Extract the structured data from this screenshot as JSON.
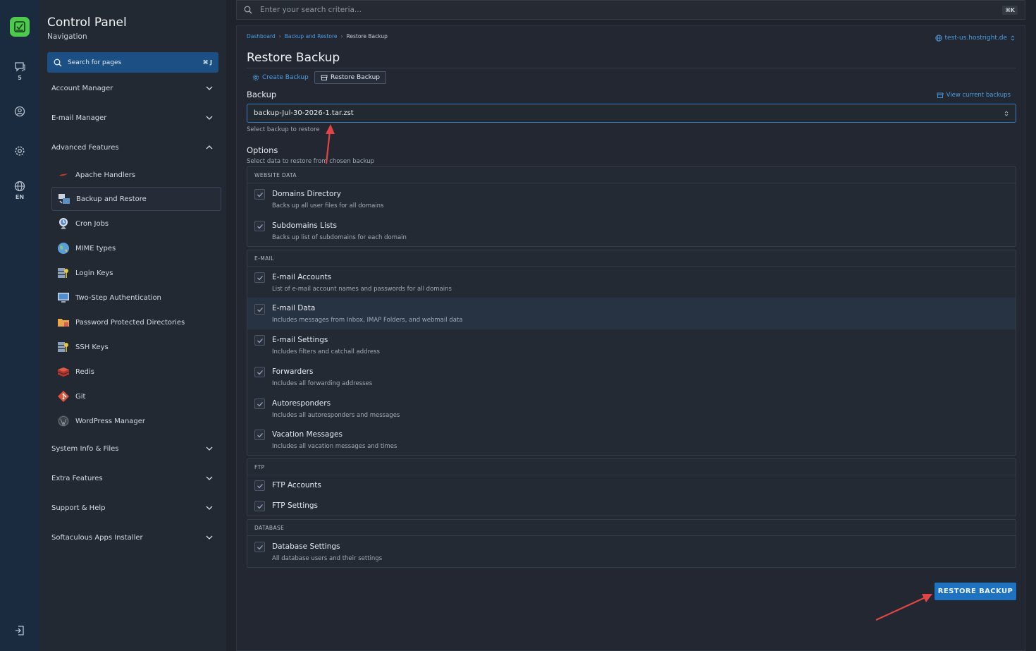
{
  "rail": {
    "chat_count": "5",
    "language": "EN",
    "brand_color": "#4ec94e"
  },
  "sidebar": {
    "title": "Control Panel",
    "subtitle": "Navigation",
    "search_label": "Search for pages",
    "search_shortcut": "⌘ J",
    "sections_top": [
      {
        "label": "Account Manager",
        "expanded": false
      },
      {
        "label": "E-mail Manager",
        "expanded": false
      },
      {
        "label": "Advanced Features",
        "expanded": true
      }
    ],
    "items": [
      {
        "label": "Apache Handlers",
        "icon": "feather-icon"
      },
      {
        "label": "Backup and Restore",
        "icon": "backup-icon",
        "active": true
      },
      {
        "label": "Cron Jobs",
        "icon": "clock-icon"
      },
      {
        "label": "MIME types",
        "icon": "globe-icon"
      },
      {
        "label": "Login Keys",
        "icon": "server-key-icon"
      },
      {
        "label": "Two-Step Authentication",
        "icon": "monitor-icon"
      },
      {
        "label": "Password Protected Directories",
        "icon": "folder-lock-icon"
      },
      {
        "label": "SSH Keys",
        "icon": "server-key-icon"
      },
      {
        "label": "Redis",
        "icon": "redis-icon"
      },
      {
        "label": "Git",
        "icon": "git-icon"
      },
      {
        "label": "WordPress Manager",
        "icon": "wordpress-icon"
      }
    ],
    "sections_bottom": [
      {
        "label": "System Info & Files",
        "expanded": false
      },
      {
        "label": "Extra Features",
        "expanded": false
      },
      {
        "label": "Support & Help",
        "expanded": false
      },
      {
        "label": "Softaculous Apps Installer",
        "expanded": false
      }
    ]
  },
  "topbar": {
    "search_placeholder": "Enter your search criteria...",
    "shortcut": "⌘K"
  },
  "main": {
    "breadcrumbs": [
      "Dashboard",
      "Backup and Restore",
      "Restore Backup"
    ],
    "domain": "test-us.hostright.de",
    "title": "Restore Backup",
    "tabs": [
      {
        "label": "Create Backup",
        "active": false
      },
      {
        "label": "Restore Backup",
        "active": true
      }
    ],
    "backup_label": "Backup",
    "view_current_label": "View current backups",
    "selected_backup": "backup-Jul-30-2026-1.tar.zst",
    "select_help": "Select backup to restore",
    "options_title": "Options",
    "options_subtitle": "Select data to restore from chosen backup",
    "groups": [
      {
        "header": "WEBSITE DATA",
        "rows": [
          {
            "name": "Domains Directory",
            "desc": "Backs up all user files for all domains",
            "checked": true
          },
          {
            "name": "Subdomains Lists",
            "desc": "Backs up list of subdomains for each domain",
            "checked": true
          }
        ]
      },
      {
        "header": "E-MAIL",
        "rows": [
          {
            "name": "E-mail Accounts",
            "desc": "List of e-mail account names and passwords for all domains",
            "checked": true
          },
          {
            "name": "E-mail Data",
            "desc": "Includes messages from Inbox, IMAP Folders, and webmail data",
            "checked": true
          },
          {
            "name": "E-mail Settings",
            "desc": "Includes filters and catchall address",
            "checked": true
          },
          {
            "name": "Forwarders",
            "desc": "Includes all forwarding addresses",
            "checked": true
          },
          {
            "name": "Autoresponders",
            "desc": "Includes all autoresponders and messages",
            "checked": true
          },
          {
            "name": "Vacation Messages",
            "desc": "Includes all vacation messages and times",
            "checked": true
          }
        ]
      },
      {
        "header": "FTP",
        "rows": [
          {
            "name": "FTP Accounts",
            "checked": true
          },
          {
            "name": "FTP Settings",
            "checked": true
          }
        ]
      },
      {
        "header": "DATABASE",
        "rows": [
          {
            "name": "Database Settings",
            "desc": "All database users and their settings",
            "checked": true
          }
        ]
      }
    ],
    "restore_button": "RESTORE BACKUP",
    "accent_color": "#1e72c0",
    "annotation_arrow_color": "#e04545"
  }
}
